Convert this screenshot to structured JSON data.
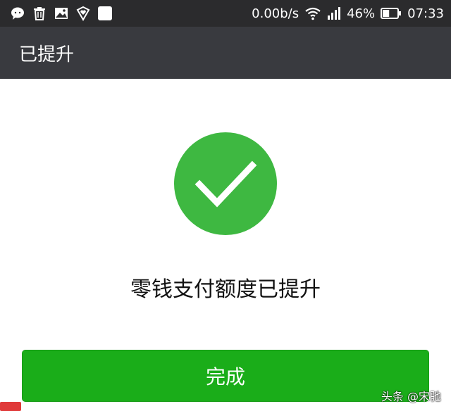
{
  "status_bar": {
    "net_speed": "0.00b/s",
    "battery_percent": "46%",
    "battery_level": 0.46,
    "time": "07:33",
    "left_icons": [
      "chat-bubble-icon",
      "trash-icon",
      "image-icon",
      "shield-heart-icon",
      "square-icon"
    ]
  },
  "header": {
    "title": "已提升"
  },
  "main": {
    "status_icon": "checkmark-icon",
    "message": "零钱支付额度已提升",
    "done_label": "完成"
  },
  "watermark": {
    "text": "头条 @宋驰"
  },
  "colors": {
    "status_bar": "#2b2b2d",
    "title_bar": "#393a3f",
    "success_green": "#3eb841",
    "button_green": "#1aad19",
    "watermark_seal": "#e03a3a"
  }
}
